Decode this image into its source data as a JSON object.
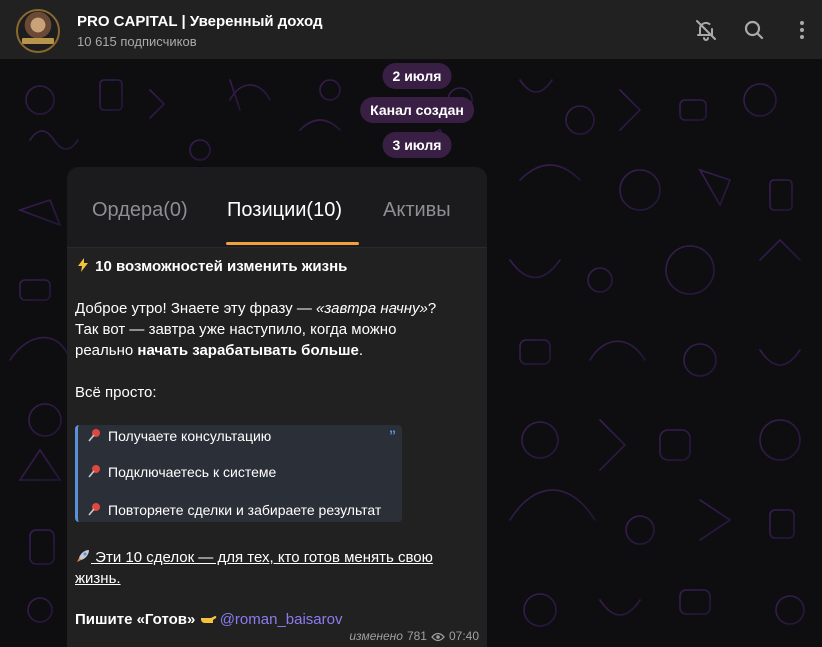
{
  "header": {
    "title": "PRO CAPITAL | Уверенный доход",
    "subscribers": "10 615 подписчиков",
    "icons": [
      "bell-off-icon",
      "search-icon",
      "more-vertical-icon"
    ]
  },
  "timeline": {
    "date1": "2 июля",
    "service": "Канал создан",
    "date2": "3 июля"
  },
  "media": {
    "tabs": [
      {
        "label": "Ордера(0)",
        "active": false
      },
      {
        "label": "Позиции(10)",
        "active": true
      },
      {
        "label": "Активы",
        "active": false
      }
    ],
    "accent": "#f2a13a"
  },
  "message": {
    "headline": "10 возможностей изменить жизнь",
    "p1_a": "Доброе утро! Знаете эту фразу — ",
    "p1_italic": "«завтра начну»",
    "p1_b": "?",
    "p2": "Так вот — завтра уже наступило, когда можно",
    "p3_a": "реально ",
    "p3_bold": "начать зарабатывать больше",
    "p3_b": ".",
    "p4": "Всё просто:",
    "quote": {
      "items": [
        "Получаете консультацию",
        "Подключаетесь к системе",
        "Повторяете сделки и забираете результат"
      ],
      "mark": "”"
    },
    "link_line1": " Эти 10 сделок — для тех, кто готов менять свою",
    "link_line2": "жизнь.",
    "cta_bold": "Пишите «Готов»",
    "cta_mention": "@roman_baisarov",
    "meta": {
      "edited": "изменено",
      "views": "781",
      "time": "07:40"
    }
  },
  "colors": {
    "header_bg": "#212121",
    "bubble_bg": "#212121",
    "pill_bg": "#3a1f44",
    "quote_border": "#5b8fd9",
    "mention": "#8b7cf0"
  }
}
